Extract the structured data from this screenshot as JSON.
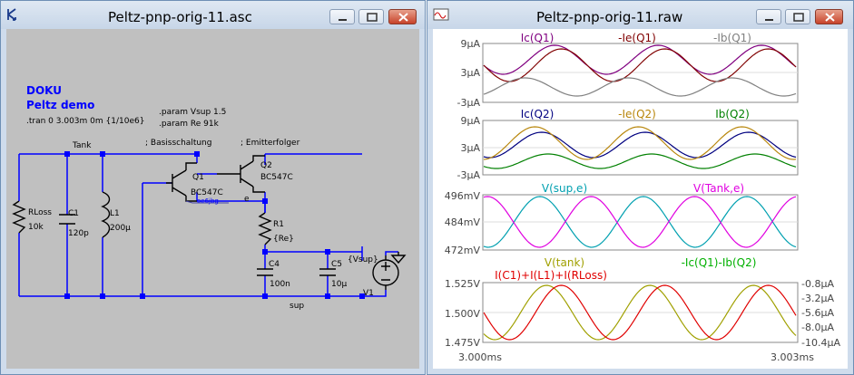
{
  "colors": {
    "wire": "#0000ff",
    "comp": "#000000",
    "junction": "#0000ff",
    "bg": "#c0c0c0",
    "blue_text": "#0000ff"
  },
  "left_window": {
    "title": "Peltz-pnp-orig-11.asc",
    "icon": "ltspice-schematic-icon"
  },
  "right_window": {
    "title": "Peltz-pnp-orig-11.raw",
    "icon": "waveform-viewer-icon"
  },
  "schematic": {
    "doku": "DOKU",
    "peltz": "Peltz demo",
    "tran": ".tran 0 3.003m 0m {1/10e6}",
    "param_vsup": ".param Vsup 1.5",
    "param_re": ".param Re 91k",
    "tank": "Tank",
    "basis": "; Basisschaltung",
    "emitter": "; Emitterfolger",
    "q1": "Q1",
    "q1_model": "BC547C",
    "q1_note": "oe6jbg",
    "q2": "Q2",
    "q2_model": "BC547C",
    "node_e": "e",
    "r1": "R1",
    "r1_val": "{Re}",
    "rloss": "RLoss",
    "rloss_val": "10k",
    "c1": "C1",
    "c1_val": "120p",
    "l1": "L1",
    "l1_val": "200µ",
    "c4": "C4",
    "c4_val": "100n",
    "c5": "C5",
    "c5_val": "10µ",
    "vsup_label": "{Vsup}",
    "v1": "V1",
    "sup": "sup"
  },
  "plot": {
    "pane1": {
      "labels": [
        {
          "text": "Ic(Q1)",
          "color": "#800080"
        },
        {
          "text": "-Ie(Q1)",
          "color": "#800000"
        },
        {
          "text": "-Ib(Q1)",
          "color": "#808080"
        }
      ],
      "yticks": [
        "9µA",
        "3µA",
        "-3µA"
      ]
    },
    "pane2": {
      "labels": [
        {
          "text": "Ic(Q2)",
          "color": "#000080"
        },
        {
          "text": "-Ie(Q2)",
          "color": "#b8860b"
        },
        {
          "text": "Ib(Q2)",
          "color": "#008000"
        }
      ],
      "yticks": [
        "9µA",
        "3µA",
        "-3µA"
      ]
    },
    "pane3": {
      "labels": [
        {
          "text": "V(sup,e)",
          "color": "#00a0b0"
        },
        {
          "text": "V(Tank,e)",
          "color": "#e000e0"
        }
      ],
      "yticks": [
        "496mV",
        "484mV",
        "472mV"
      ]
    },
    "pane4": {
      "labels": [
        {
          "text": "V(tank)",
          "color": "#a0a000"
        },
        {
          "text": "-Ic(Q1)-Ib(Q2)",
          "color": "#00b000"
        },
        {
          "text": "I(C1)+I(L1)+I(RLoss)",
          "color": "#e00000"
        }
      ],
      "yticks_left": [
        "1.525V",
        "1.500V",
        "1.475V"
      ],
      "yticks_right": [
        "-0.8µA",
        "-3.2µA",
        "-5.6µA",
        "-8.0µA",
        "-10.4µA"
      ]
    },
    "xticks": [
      "3.000ms",
      "3.003ms"
    ]
  }
}
